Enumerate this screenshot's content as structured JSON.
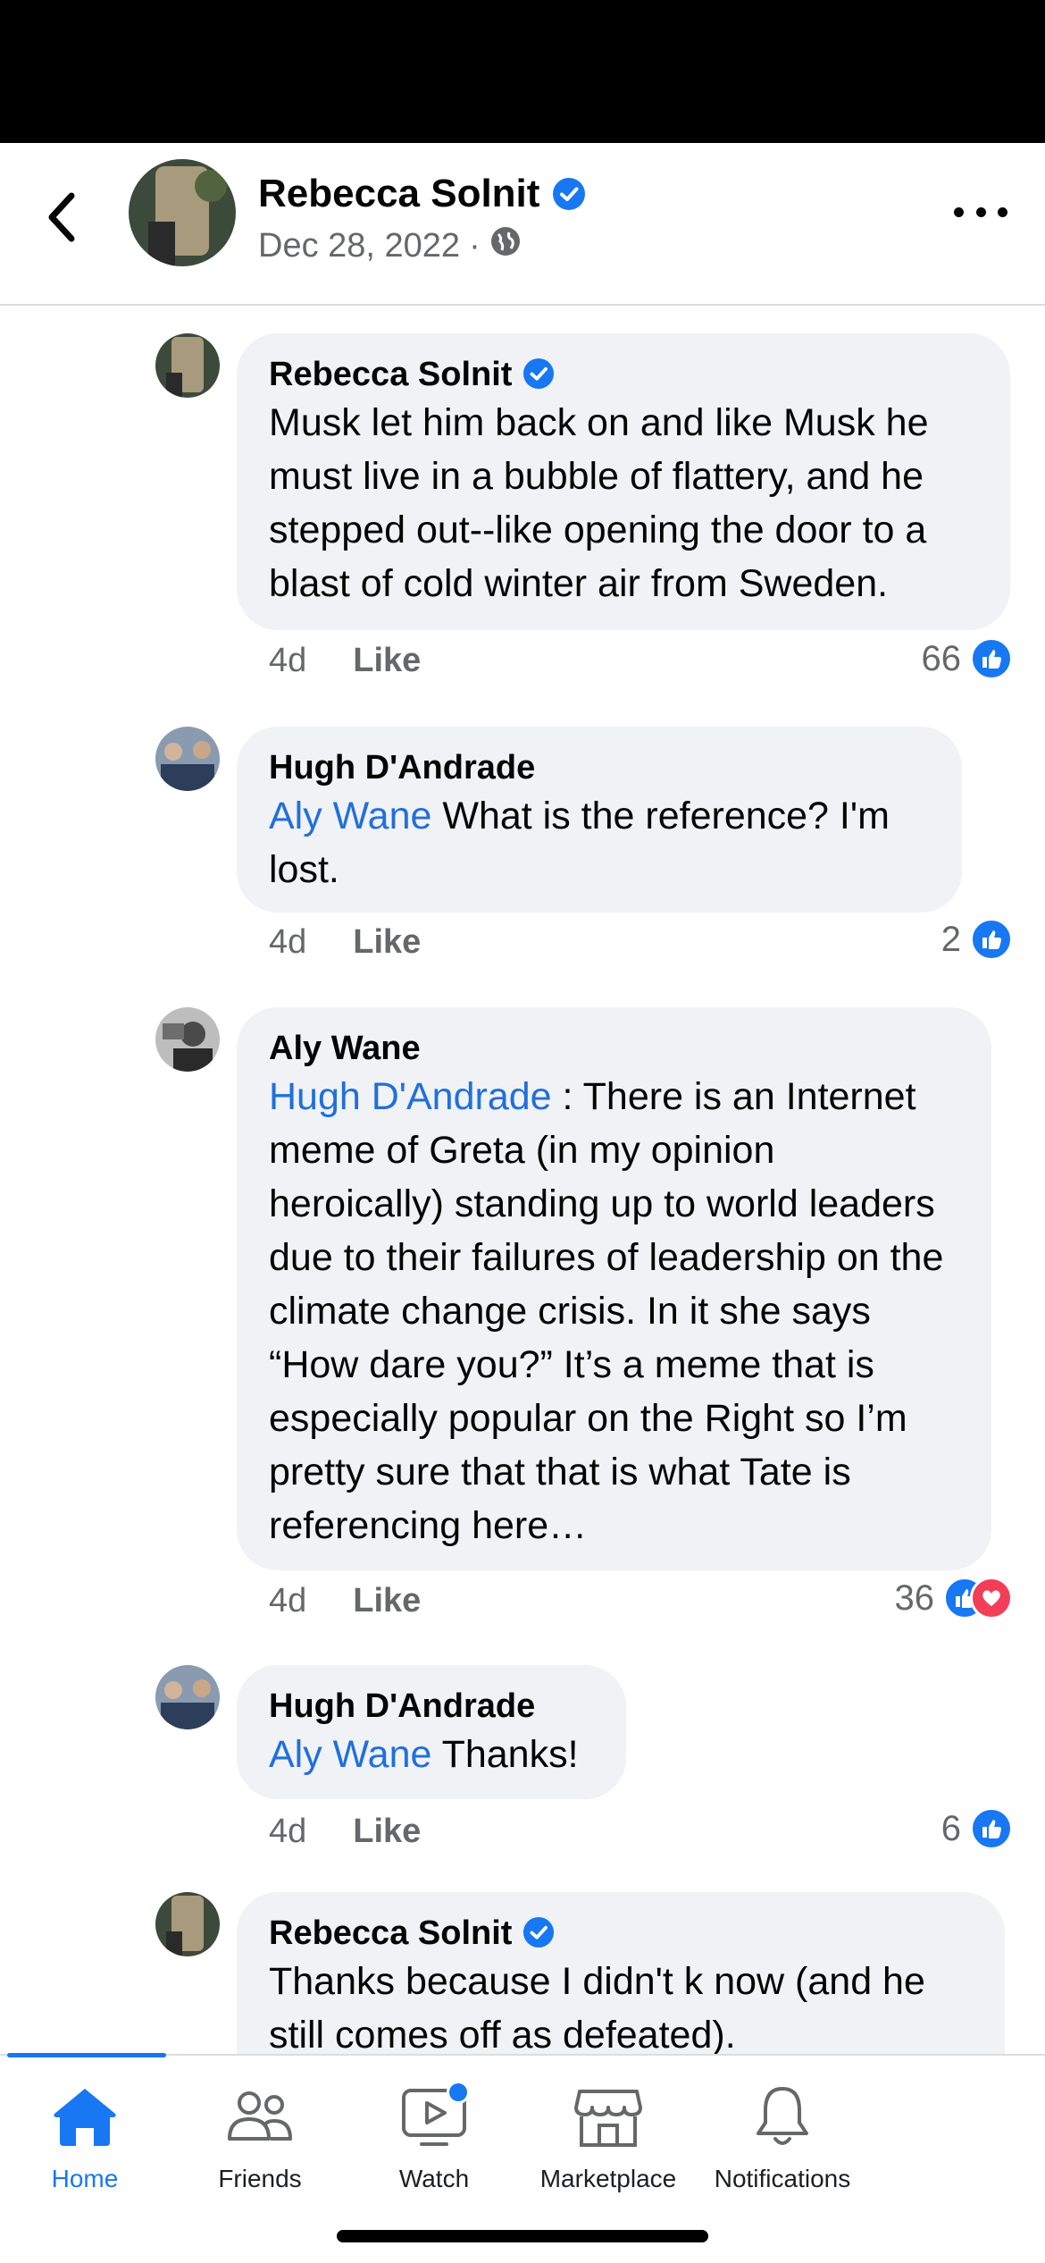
{
  "header": {
    "author": "Rebecca Solnit",
    "date": "Dec 28, 2022",
    "separator": "·",
    "privacy_icon": "globe-icon",
    "verified_icon": "verified-badge-icon"
  },
  "comments": [
    {
      "author": "Rebecca Solnit",
      "verified": true,
      "mention": "",
      "text": "Musk let him back on and like Musk he must live in a bubble of flattery, and he stepped out--like opening the door to a blast of cold winter air from Sweden.",
      "time": "4d",
      "like_label": "Like",
      "reaction_count": "66",
      "reactions": [
        "like"
      ]
    },
    {
      "author": "Hugh D'Andrade",
      "verified": false,
      "mention": "Aly Wane",
      "text": " What is the reference? I'm lost.",
      "time": "4d",
      "like_label": "Like",
      "reaction_count": "2",
      "reactions": [
        "like"
      ]
    },
    {
      "author": "Aly Wane",
      "verified": false,
      "mention": "Hugh D'Andrade",
      "text": " : There is an Internet meme of Greta (in my opinion heroically) standing up to world leaders due to their failures of leadership on the climate change crisis. In it she says “How dare you?” It’s a meme that is especially popular on the Right so I’m pretty sure that that is what Tate is referencing here…",
      "time": "4d",
      "like_label": "Like",
      "reaction_count": "36",
      "reactions": [
        "like",
        "love"
      ]
    },
    {
      "author": "Hugh D'Andrade",
      "verified": false,
      "mention": "Aly Wane",
      "text": " Thanks!",
      "time": "4d",
      "like_label": "Like",
      "reaction_count": "6",
      "reactions": [
        "like"
      ]
    },
    {
      "author": "Rebecca Solnit",
      "verified": true,
      "mention": "",
      "text": "Thanks because I didn't k now (and he still comes off as defeated).",
      "time": "",
      "like_label": "",
      "reaction_count": "",
      "reactions": []
    }
  ],
  "tabbar": {
    "tabs": [
      {
        "label": "Home",
        "icon": "home-icon",
        "active": true
      },
      {
        "label": "Friends",
        "icon": "friends-icon",
        "active": false
      },
      {
        "label": "Watch",
        "icon": "watch-icon",
        "active": false,
        "badge": true
      },
      {
        "label": "Marketplace",
        "icon": "marketplace-icon",
        "active": false
      },
      {
        "label": "Notifications",
        "icon": "bell-icon",
        "active": false
      }
    ]
  },
  "colors": {
    "accent": "#1877f2",
    "mention": "#216fdb",
    "bubble": "#f0f2f5",
    "secondary_text": "#65676b",
    "love": "#f33e58"
  }
}
